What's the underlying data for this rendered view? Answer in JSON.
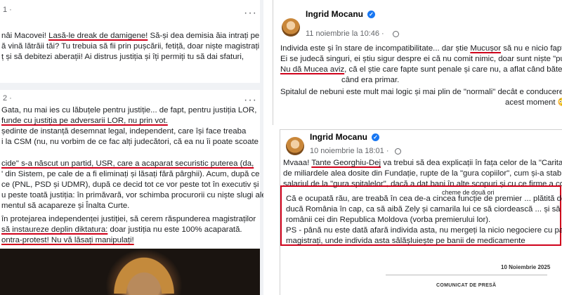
{
  "left_post_1": {
    "meta": "1 · ",
    "lines": [
      {
        "pre": "nâi Macovei! ",
        "u": "Lasă-le dreak de damigene!",
        "post": " Să-și dea demisia ăia intrați pe"
      },
      {
        "pre": "ă vină lătrăii tăi? Tu trebuia să fii prin pușcării, fetiță, doar niște magistrați",
        "u": "",
        "post": ""
      },
      {
        "pre": "ț și să debitezi aberații! Ai distrus justiția și îți permiți tu să dai sfaturi,",
        "u": "",
        "post": ""
      }
    ]
  },
  "left_post_2": {
    "meta": "2 · ",
    "lines": [
      {
        "pre": "Gata, nu mai ies cu lăbuțele pentru justiție... de fapt, pentru justiția LOR,",
        "u": "",
        "post": ""
      },
      {
        "pre": "",
        "u": "funde cu justiția pe adversarii LOR, nu prin vot.",
        "post": ""
      },
      {
        "pre": "ședinte de instanță desemnat legal, independent, care își face treaba",
        "u": "",
        "post": ""
      },
      {
        "pre": "i la CSM (nu, nu vorbim de ce fac alți judecători, că ea nu îi poate scoate",
        "u": "",
        "post": ""
      },
      {
        "pre": "",
        "u": "cide\" s-a născut un partid, USR, care a acaparat securistic puterea (da,",
        "post": ""
      },
      {
        "pre": "' din Sistem, pe cale de a fi eliminați și lăsați fără pârghii). Acum, după ce",
        "u": "",
        "post": ""
      },
      {
        "pre": "ce (PNL, PSD și UDMR), după ce decid tot ce vor peste tot în executiv și",
        "u": "",
        "post": ""
      },
      {
        "pre": "u peste toată justiția: în primăvară, vor schimba procurorii cu niște slugi ale",
        "u": "",
        "post": ""
      },
      {
        "pre": "mentul să acapareze și Înalta Curte.",
        "u": "",
        "post": ""
      },
      {
        "pre": " în protejarea independenței justiției, să cerem răspunderea magistraților",
        "u": "",
        "post": ""
      },
      {
        "pre": "",
        "u": "să instaureze deplin diktatura:",
        "post": " doar justiția nu este 100% acaparată."
      },
      {
        "pre": "",
        "u": "ontra-protest! Nu vă lăsați manipulați!",
        "post": ""
      }
    ]
  },
  "right_post_1": {
    "author": "Ingrid Mocanu",
    "date": "11 noiembrie la 10:46 ·",
    "lines": [
      {
        "pre": "Individa este și în stare de incompatibilitate... dar știe ",
        "u": "Mucușor",
        "post": " să nu e nicio fapt"
      },
      {
        "pre": "Ei se judecă singuri, ei știu sigur despre ei că nu comit nimic, doar sunt niște \"puri\"",
        "u": "",
        "post": ""
      },
      {
        "pre": "",
        "u": "Nu dă Mucea aviz",
        "post": ", că el știe care fapte sunt penale și care  nu, a aflat când bătea s"
      },
      {
        "pre": "când era primar.",
        "u": "",
        "post": ""
      },
      {
        "pre": "Spitalul de nebuni este mult mai logic și mai plin de \"normali\" decât e conducerea",
        "u": "",
        "post": ""
      },
      {
        "pre": "acest moment 😳",
        "u": "",
        "post": ""
      }
    ]
  },
  "right_post_2": {
    "author": "Ingrid Mocanu",
    "date": "10 noiembrie la 18:01 ·",
    "lines": [
      {
        "pre": "Mvaaa! ",
        "u": "Tante Georghiu-Dej",
        "post": " va trebui să dea explicații în fața celor de la \"Caritas"
      },
      {
        "pre": "de miliardele alea dosite din Fundație, rupte de la \"gura copiilor\", cum și-a stab",
        "u": "",
        "post": ""
      },
      {
        "pre": "salariul de la \"gura spitalelor\", dacă a dat bani în alte scopuri și cu ce firme a con",
        "u": "",
        "post": ""
      },
      {
        "pre": "cheme de două ori",
        "u": "",
        "post": ""
      }
    ],
    "boxed_lines": [
      "Că e ocupată rău, are treabă în cea de-a cincea funcție de premier ... plătită de l",
      "ducă România în cap, ca să aibă Zely și camarila lui ce să ciordească ... și să o d",
      "românii cei din Republica Moldova (vorba premierului lor).",
      "PS - până nu este dată afară individa asta, nu mergeți la nicio negociere cu pala",
      "magistrați, unde individa asta sălășluiește pe banii de medicamente"
    ],
    "doc_date": "10 Noiembrie 2025",
    "doc_heading": "COMUNICAT DE PRESĂ"
  },
  "icons": {
    "more": "more-options-icon",
    "verified": "verified-badge-icon",
    "audience": "globe-icon"
  },
  "colors": {
    "underline": "#d0021b",
    "verified": "#1877f2",
    "feed_bg": "#f0f2f5"
  }
}
